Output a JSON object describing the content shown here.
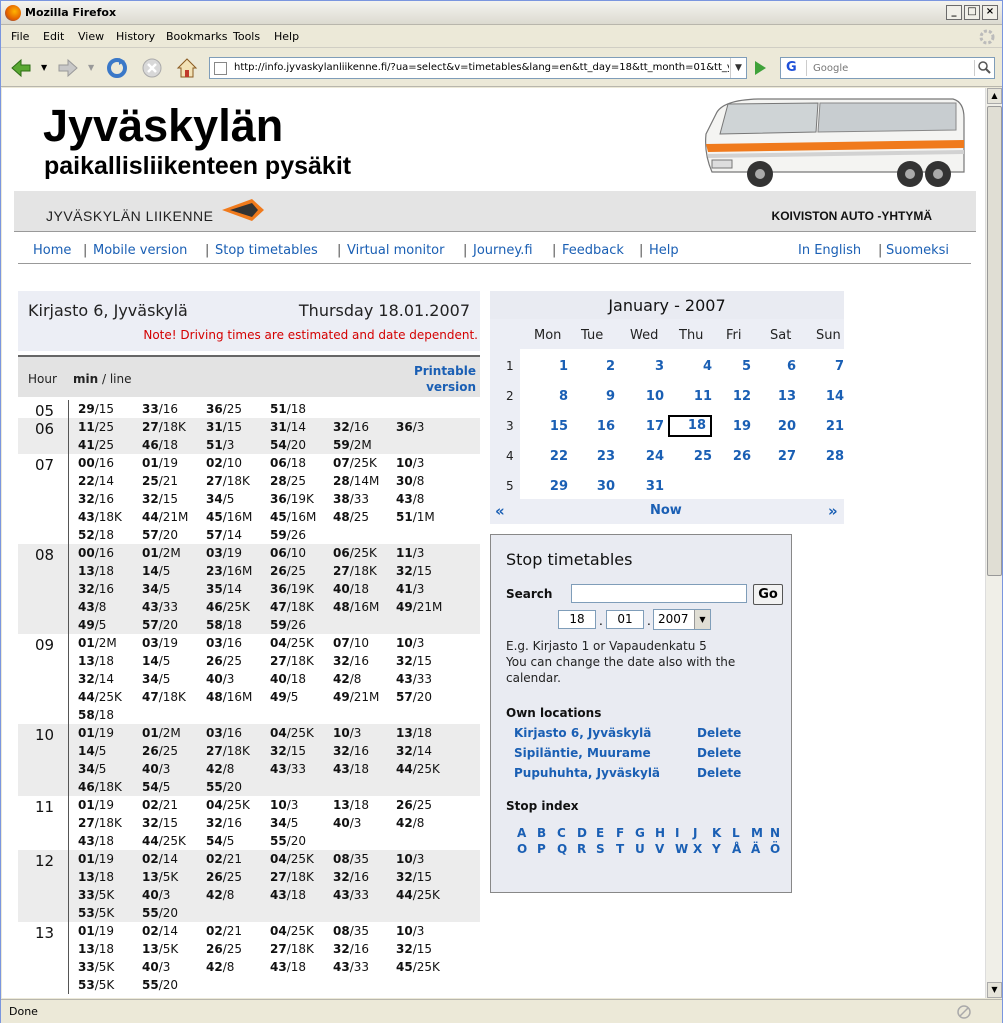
{
  "window": {
    "title": "Mozilla Firefox"
  },
  "menu": [
    "File",
    "Edit",
    "View",
    "History",
    "Bookmarks",
    "Tools",
    "Help"
  ],
  "toolbar": {
    "url": "http://info.jyvaskylanliikenne.fi/?ua=select&v=timetables&lang=en&tt_day=18&tt_month=01&tt_year=2007",
    "search_placeholder": "Google"
  },
  "status": "Done",
  "header": {
    "title": "Jyväskylän",
    "subtitle": "paikallisliikenteen pysäkit",
    "left_brand": "JYVÄSKYLÄN LIIKENNE",
    "right_brand": "KOIVISTON AUTO -YHTYMÄ"
  },
  "nav": {
    "left": [
      "Home",
      "Mobile version",
      "Stop timetables",
      "Virtual monitor",
      "Journey.fi",
      "Feedback",
      "Help"
    ],
    "right": [
      "In English",
      "Suomeksi"
    ]
  },
  "timetable": {
    "stop": "Kirjasto 6, Jyväskylä",
    "date": "Thursday 18.01.2007",
    "note": "Note! Driving times are estimated and date dependent.",
    "hour_label": "Hour",
    "min_label": "min",
    "line_label": " / line",
    "printable": [
      "Printable",
      "version"
    ],
    "hours": [
      {
        "hour": "05",
        "deps": [
          [
            "29",
            "15"
          ],
          [
            "33",
            "16"
          ],
          [
            "36",
            "25"
          ],
          [
            "51",
            "18"
          ]
        ]
      },
      {
        "hour": "06",
        "deps": [
          [
            "11",
            "25"
          ],
          [
            "27",
            "18K"
          ],
          [
            "31",
            "15"
          ],
          [
            "31",
            "14"
          ],
          [
            "32",
            "16"
          ],
          [
            "36",
            "3"
          ],
          [
            "41",
            "25"
          ],
          [
            "46",
            "18"
          ],
          [
            "51",
            "3"
          ],
          [
            "54",
            "20"
          ],
          [
            "59",
            "2M"
          ]
        ]
      },
      {
        "hour": "07",
        "deps": [
          [
            "00",
            "16"
          ],
          [
            "01",
            "19"
          ],
          [
            "02",
            "10"
          ],
          [
            "06",
            "18"
          ],
          [
            "07",
            "25K"
          ],
          [
            "10",
            "3"
          ],
          [
            "22",
            "14"
          ],
          [
            "25",
            "21"
          ],
          [
            "27",
            "18K"
          ],
          [
            "28",
            "25"
          ],
          [
            "28",
            "14M"
          ],
          [
            "30",
            "8"
          ],
          [
            "32",
            "16"
          ],
          [
            "32",
            "15"
          ],
          [
            "34",
            "5"
          ],
          [
            "36",
            "19K"
          ],
          [
            "38",
            "33"
          ],
          [
            "43",
            "8"
          ],
          [
            "43",
            "18K"
          ],
          [
            "44",
            "21M"
          ],
          [
            "45",
            "16M"
          ],
          [
            "45",
            "16M"
          ],
          [
            "48",
            "25"
          ],
          [
            "51",
            "1M"
          ],
          [
            "52",
            "18"
          ],
          [
            "57",
            "20"
          ],
          [
            "57",
            "14"
          ],
          [
            "59",
            "26"
          ]
        ]
      },
      {
        "hour": "08",
        "deps": [
          [
            "00",
            "16"
          ],
          [
            "01",
            "2M"
          ],
          [
            "03",
            "19"
          ],
          [
            "06",
            "10"
          ],
          [
            "06",
            "25K"
          ],
          [
            "11",
            "3"
          ],
          [
            "13",
            "18"
          ],
          [
            "14",
            "5"
          ],
          [
            "23",
            "16M"
          ],
          [
            "26",
            "25"
          ],
          [
            "27",
            "18K"
          ],
          [
            "32",
            "15"
          ],
          [
            "32",
            "16"
          ],
          [
            "34",
            "5"
          ],
          [
            "35",
            "14"
          ],
          [
            "36",
            "19K"
          ],
          [
            "40",
            "18"
          ],
          [
            "41",
            "3"
          ],
          [
            "43",
            "8"
          ],
          [
            "43",
            "33"
          ],
          [
            "46",
            "25K"
          ],
          [
            "47",
            "18K"
          ],
          [
            "48",
            "16M"
          ],
          [
            "49",
            "21M"
          ],
          [
            "49",
            "5"
          ],
          [
            "57",
            "20"
          ],
          [
            "58",
            "18"
          ],
          [
            "59",
            "26"
          ]
        ]
      },
      {
        "hour": "09",
        "deps": [
          [
            "01",
            "2M"
          ],
          [
            "03",
            "19"
          ],
          [
            "03",
            "16"
          ],
          [
            "04",
            "25K"
          ],
          [
            "07",
            "10"
          ],
          [
            "10",
            "3"
          ],
          [
            "13",
            "18"
          ],
          [
            "14",
            "5"
          ],
          [
            "26",
            "25"
          ],
          [
            "27",
            "18K"
          ],
          [
            "32",
            "16"
          ],
          [
            "32",
            "15"
          ],
          [
            "32",
            "14"
          ],
          [
            "34",
            "5"
          ],
          [
            "40",
            "3"
          ],
          [
            "40",
            "18"
          ],
          [
            "42",
            "8"
          ],
          [
            "43",
            "33"
          ],
          [
            "44",
            "25K"
          ],
          [
            "47",
            "18K"
          ],
          [
            "48",
            "16M"
          ],
          [
            "49",
            "5"
          ],
          [
            "49",
            "21M"
          ],
          [
            "57",
            "20"
          ],
          [
            "58",
            "18"
          ]
        ]
      },
      {
        "hour": "10",
        "deps": [
          [
            "01",
            "19"
          ],
          [
            "01",
            "2M"
          ],
          [
            "03",
            "16"
          ],
          [
            "04",
            "25K"
          ],
          [
            "10",
            "3"
          ],
          [
            "13",
            "18"
          ],
          [
            "14",
            "5"
          ],
          [
            "26",
            "25"
          ],
          [
            "27",
            "18K"
          ],
          [
            "32",
            "15"
          ],
          [
            "32",
            "16"
          ],
          [
            "32",
            "14"
          ],
          [
            "34",
            "5"
          ],
          [
            "40",
            "3"
          ],
          [
            "42",
            "8"
          ],
          [
            "43",
            "33"
          ],
          [
            "43",
            "18"
          ],
          [
            "44",
            "25K"
          ],
          [
            "46",
            "18K"
          ],
          [
            "54",
            "5"
          ],
          [
            "55",
            "20"
          ]
        ]
      },
      {
        "hour": "11",
        "deps": [
          [
            "01",
            "19"
          ],
          [
            "02",
            "21"
          ],
          [
            "04",
            "25K"
          ],
          [
            "10",
            "3"
          ],
          [
            "13",
            "18"
          ],
          [
            "26",
            "25"
          ],
          [
            "27",
            "18K"
          ],
          [
            "32",
            "15"
          ],
          [
            "32",
            "16"
          ],
          [
            "34",
            "5"
          ],
          [
            "40",
            "3"
          ],
          [
            "42",
            "8"
          ],
          [
            "43",
            "18"
          ],
          [
            "44",
            "25K"
          ],
          [
            "54",
            "5"
          ],
          [
            "55",
            "20"
          ]
        ]
      },
      {
        "hour": "12",
        "deps": [
          [
            "01",
            "19"
          ],
          [
            "02",
            "14"
          ],
          [
            "02",
            "21"
          ],
          [
            "04",
            "25K"
          ],
          [
            "08",
            "35"
          ],
          [
            "10",
            "3"
          ],
          [
            "13",
            "18"
          ],
          [
            "13",
            "5K"
          ],
          [
            "26",
            "25"
          ],
          [
            "27",
            "18K"
          ],
          [
            "32",
            "16"
          ],
          [
            "32",
            "15"
          ],
          [
            "33",
            "5K"
          ],
          [
            "40",
            "3"
          ],
          [
            "42",
            "8"
          ],
          [
            "43",
            "18"
          ],
          [
            "43",
            "33"
          ],
          [
            "44",
            "25K"
          ],
          [
            "53",
            "5K"
          ],
          [
            "55",
            "20"
          ]
        ]
      },
      {
        "hour": "13",
        "deps": [
          [
            "01",
            "19"
          ],
          [
            "02",
            "14"
          ],
          [
            "02",
            "21"
          ],
          [
            "04",
            "25K"
          ],
          [
            "08",
            "35"
          ],
          [
            "10",
            "3"
          ],
          [
            "13",
            "18"
          ],
          [
            "13",
            "5K"
          ],
          [
            "26",
            "25"
          ],
          [
            "27",
            "18K"
          ],
          [
            "32",
            "16"
          ],
          [
            "32",
            "15"
          ],
          [
            "33",
            "5K"
          ],
          [
            "40",
            "3"
          ],
          [
            "42",
            "8"
          ],
          [
            "43",
            "18"
          ],
          [
            "43",
            "33"
          ],
          [
            "45",
            "25K"
          ],
          [
            "53",
            "5K"
          ],
          [
            "55",
            "20"
          ]
        ]
      }
    ]
  },
  "calendar": {
    "month": "January - 2007",
    "weekdays": [
      "Mon",
      "Tue",
      "Wed",
      "Thu",
      "Fri",
      "Sat",
      "Sun"
    ],
    "weeks": [
      {
        "no": "1",
        "days": [
          "1",
          "2",
          "3",
          "4",
          "5",
          "6",
          "7"
        ]
      },
      {
        "no": "2",
        "days": [
          "8",
          "9",
          "10",
          "11",
          "12",
          "13",
          "14"
        ]
      },
      {
        "no": "3",
        "days": [
          "15",
          "16",
          "17",
          "18",
          "19",
          "20",
          "21"
        ]
      },
      {
        "no": "4",
        "days": [
          "22",
          "23",
          "24",
          "25",
          "26",
          "27",
          "28"
        ]
      },
      {
        "no": "5",
        "days": [
          "29",
          "30",
          "31",
          "",
          "",
          "",
          ""
        ]
      }
    ],
    "selected": "18",
    "prev": "«",
    "next": "»",
    "now": "Now"
  },
  "stop_box": {
    "title": "Stop timetables",
    "search_label": "Search",
    "go": "Go",
    "day": "18",
    "month": "01",
    "year": "2007",
    "example": "E.g. Kirjasto 1 or Vapaudenkatu 5",
    "hint": "You can change the date also with the calendar.",
    "own_title": "Own locations",
    "own": [
      {
        "name": "Kirjasto 6, Jyväskylä",
        "action": "Delete"
      },
      {
        "name": "Sipiläntie, Muurame",
        "action": "Delete"
      },
      {
        "name": "Pupuhuhta, Jyväskylä",
        "action": "Delete"
      }
    ],
    "index_title": "Stop index",
    "index_letters": [
      "A",
      "B",
      "C",
      "D",
      "E",
      "F",
      "G",
      "H",
      "I",
      "J",
      "K",
      "L",
      "M",
      "N",
      "O",
      "P",
      "Q",
      "R",
      "S",
      "T",
      "U",
      "V",
      "W",
      "X",
      "Y",
      "Å",
      "Ä",
      "Ö"
    ]
  }
}
